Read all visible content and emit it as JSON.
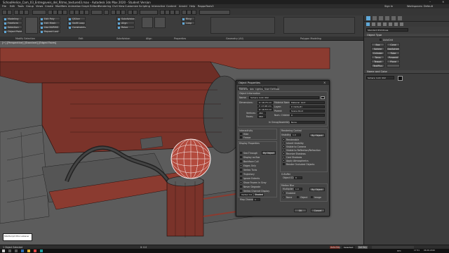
{
  "app": {
    "title": "SchoolHelice_Cam_03_Entregaveis_del_Ritmo_textured3.max - Autodesk 3ds Max 2020 - Student Version",
    "workspaces_label": "Workspaces: Default",
    "sign_in": "Sign In"
  },
  "menu": [
    "File",
    "Edit",
    "Tools",
    "Group",
    "Views",
    "Create",
    "Modifiers",
    "Animation",
    "Graph Editors",
    "Rendering",
    "Civil View",
    "Customize",
    "Scripting",
    "Interactive",
    "Content",
    "Arnold",
    "Help",
    "RappaTools3"
  ],
  "ribbon": {
    "buttons": [
      "Modeling",
      "Freeform",
      "Selection",
      "Object Paint",
      "Populate"
    ],
    "polygon_buttons": [
      "Edit Poly",
      "Edit Mesh",
      "Use NURMS",
      "Repeat Last",
      "QSlice",
      "Swift Loop",
      "Constraints",
      "Subdivision",
      "Align",
      "Relax",
      "Ring",
      "Loop"
    ],
    "sections": [
      "Modify Selection",
      "Edit",
      "Subdivision",
      "Align",
      "Properties",
      "Geometry (All)",
      "Polygon Modeling"
    ]
  },
  "viewport": {
    "label": "[+] [Perspective] [Standard] [Edged Faces]",
    "bg_color": "#5c5c5c",
    "model_color": "#8b3b30"
  },
  "command_panel": {
    "dropdown": "Standard Primitives",
    "object_type_header": "Object Type",
    "autogrid": "AutoGrid",
    "primitives": [
      "Box",
      "Cone",
      "Sphere",
      "GeoSphere",
      "Cylinder",
      "Tube",
      "Torus",
      "Pyramid",
      "Teapot",
      "Plane",
      "TextPlus",
      ""
    ],
    "name_color_header": "Name and Color",
    "name_value": "Sphere_Joint_002"
  },
  "dialog": {
    "title": "Object Properties",
    "tabs": [
      "General",
      "Adv. Lighting",
      "User Defined"
    ],
    "object_info_header": "Object Information",
    "name_label": "Name:",
    "name_value": "Sphere_Joint_002",
    "dimensions_label": "Dimensions:",
    "dims": [
      "X: 18.75 cm",
      "Y: 17.98 cm",
      "Z: 18.53 cm"
    ],
    "vertices_label": "Vertices:",
    "vertices_value": "482",
    "faces_label": "Faces:",
    "faces_value": "960",
    "material_name_label": "Material Name:",
    "material_name_value": "Material_Joint",
    "layer_label": "Layer:",
    "layer_value": "0 (default)",
    "parent_label": "Parent:",
    "parent_value": "Scene Root",
    "num_children_label": "Num. Children:",
    "num_children_value": "0",
    "in_group_label": "In Group/Assembly:",
    "in_group_value": "None",
    "interactivity_header": "Interactivity",
    "hide_label": "Hide",
    "freeze_label": "Freeze",
    "display_props_header": "Display Properties",
    "display_props": [
      "See-Through",
      "Display as Box",
      "Backface Cull",
      "Edges Only",
      "Vertex Ticks",
      "Trajectory",
      "Ignore Extents",
      "Show Frozen in Gray",
      "Never Degrade",
      "Vertex Channel Display"
    ],
    "by_object": "By Object",
    "vertex_color": "Vertex Color",
    "shaded": "Shaded",
    "map_channel_label": "Map Channel:",
    "map_channel_value": "1",
    "rendering_header": "Rendering Control",
    "visibility_label": "Visibility:",
    "visibility_value": "1.0",
    "rendering_checks": [
      "Renderable",
      "Inherit Visibility",
      "Visible to Camera",
      "Visible to Reflection/Refraction",
      "Receive Shadows",
      "Cast Shadows",
      "Apply Atmospherics",
      "Render Occluded Objects"
    ],
    "gbuffer_header": "G-Buffer",
    "object_id_label": "Object ID:",
    "object_id_value": "0",
    "motion_blur_header": "Motion Blur",
    "multiplier_label": "Multiplier:",
    "multiplier_value": "1.0",
    "enabled_label": "Enabled",
    "none_label": "None",
    "object_label": "Object",
    "image_label": "Image",
    "ok": "OK",
    "cancel": "Cancel"
  },
  "status": {
    "selected": "1 Object Selected",
    "coords": "X: 0.0",
    "auto_key": "Auto Key",
    "selected_dropdown": "Selected",
    "set_key": "Set Key",
    "script_line": "MAXScript Mini Listener"
  },
  "taskbar": {
    "time": "17:51",
    "date": "06.06.2020",
    "lang": "РУС"
  }
}
